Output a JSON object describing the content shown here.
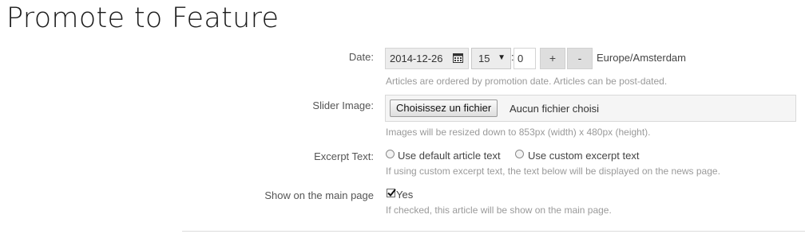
{
  "page": {
    "title": "Promote to Feature"
  },
  "date_row": {
    "label": "Date:",
    "date_value": "2014-12-26",
    "hour_value": "15",
    "minute_value": "0",
    "plus_label": "+",
    "minus_label": "-",
    "timezone": "Europe/Amsterdam",
    "help": "Articles are ordered by promotion date. Articles can be post-dated."
  },
  "slider_row": {
    "label": "Slider Image:",
    "button_label": "Choisissez un fichier",
    "status": "Aucun fichier choisi",
    "help": "Images will be resized down to 853px (width) x 480px (height)."
  },
  "excerpt_row": {
    "label": "Excerpt Text:",
    "option_default": "Use default article text",
    "option_custom": "Use custom excerpt text",
    "help": "If using custom excerpt text, the text below will be displayed on the news page."
  },
  "main_page_row": {
    "label": "Show on the main page",
    "checkbox_label": "Yes",
    "checked": true,
    "help": "If checked, this article will be show on the main page."
  },
  "icons": {
    "calendar": "calendar-icon",
    "caret": "chevron-down-icon",
    "check": "checkmark-icon"
  }
}
